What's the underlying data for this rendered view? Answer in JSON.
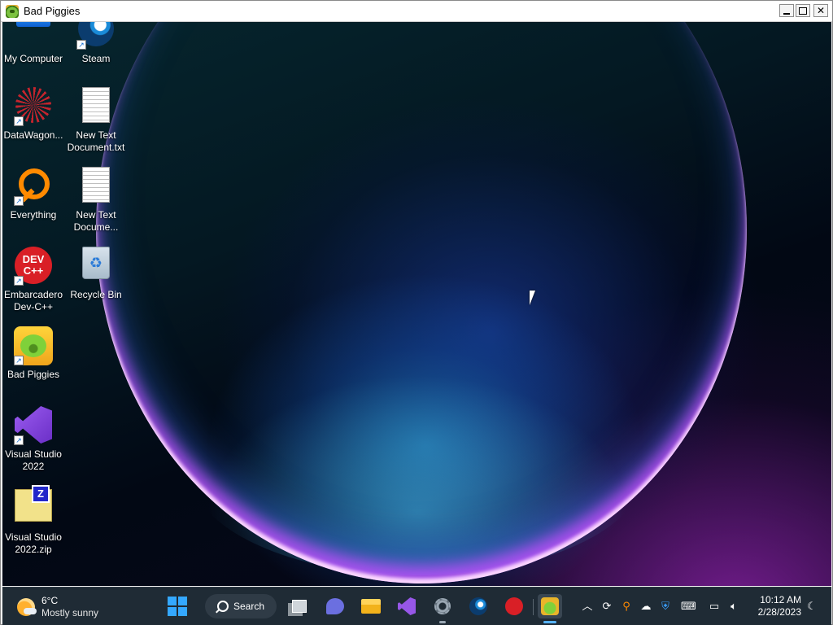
{
  "window": {
    "title": "Bad Piggies"
  },
  "desktop": {
    "icons": [
      {
        "label": "My Computer"
      },
      {
        "label": "Steam"
      },
      {
        "label": "DataWagon..."
      },
      {
        "label": "New Text Document.txt"
      },
      {
        "label": "Everything"
      },
      {
        "label": "New Text Docume..."
      },
      {
        "label": "Embarcadero Dev-C++"
      },
      {
        "label": "Recycle Bin"
      },
      {
        "label": "Bad Piggies"
      },
      {
        "label": "Visual Studio 2022"
      },
      {
        "label": "Visual Studio 2022.zip"
      }
    ],
    "devcpp_icon_text": "DEV C++"
  },
  "taskbar": {
    "weather": {
      "temperature": "6°C",
      "description": "Mostly sunny"
    },
    "search_label": "Search",
    "pinned_apps": [
      "start",
      "task-view",
      "teams-chat",
      "file-explorer",
      "visual-studio",
      "settings",
      "steam",
      "dev-cpp",
      "bad-piggies"
    ],
    "tray_icons": [
      "chevron-up",
      "sync",
      "everything-search",
      "onedrive-offline",
      "windows-security",
      "keyboard",
      "network",
      "volume",
      "focus-assist"
    ],
    "clock": {
      "time": "10:12 AM",
      "date": "2/28/2023"
    },
    "devcpp_mini_text": "DEV C++"
  },
  "colors": {
    "taskbar_bg": "#1f2b35",
    "accent": "#34a8ff"
  }
}
